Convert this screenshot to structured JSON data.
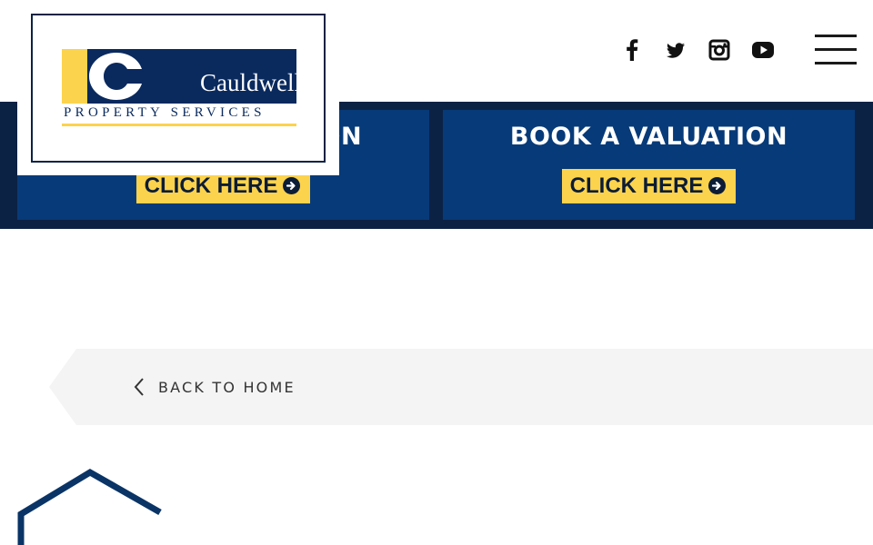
{
  "colors": {
    "navy": "#0c2244",
    "box_navy": "#073a78",
    "accent_yellow": "#fcd34d",
    "logo_navy": "#0a2a5e",
    "back_bar": "#f4f4f4"
  },
  "header": {
    "logo": {
      "brand": "Cauldwell",
      "subtitle": "PROPERTY SERVICES"
    },
    "social": [
      {
        "name": "facebook-icon"
      },
      {
        "name": "twitter-icon"
      },
      {
        "name": "instagram-icon"
      },
      {
        "name": "youtube-icon"
      }
    ],
    "menu_icon": "hamburger-menu-icon"
  },
  "banner": {
    "left_box": {
      "title": "BOOK A VALUATION",
      "button_label": "CLICK HERE"
    },
    "right_box": {
      "title": "BOOK A VALUATION",
      "button_label": "CLICK HERE"
    }
  },
  "back": {
    "label": "BACK TO HOME",
    "icon": "chevron-left-icon"
  },
  "decor": {
    "icon": "house-outline-icon"
  }
}
